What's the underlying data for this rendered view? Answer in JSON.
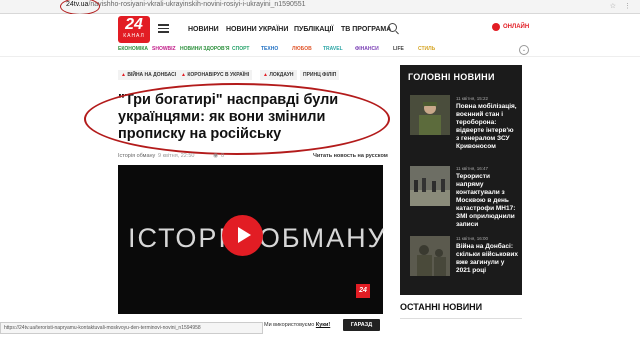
{
  "browser": {
    "url_prefix": "24tv.ua",
    "url_rest": "/navishho-rosiyani-vkrali-ukrayinskih-novini-rosiyi-i-ukrayini_n1590551"
  },
  "header": {
    "logo_number": "24",
    "logo_sub": "КАНАЛ",
    "nav": [
      "НОВИНИ",
      "НОВИНИ УКРАЇНИ",
      "ПУБЛІКАЦІЇ",
      "ТВ ПРОГРАМА"
    ],
    "online_label": "ОНЛАЙН",
    "colors": {
      "brand": "#e21d24"
    }
  },
  "categories": [
    {
      "label": "ЕКОНОМІКА",
      "color": "#2a8f3a"
    },
    {
      "label": "SHOWBIZ",
      "color": "#c21f8a"
    },
    {
      "label": "НОВИНИ ЗДОРОВ'Я",
      "color": "#2a8f3a"
    },
    {
      "label": "СПОРТ",
      "color": "#27a36b"
    },
    {
      "label": "ТЕХНО",
      "color": "#1f6fc2"
    },
    {
      "label": "ЛЮБОВ",
      "color": "#e0552a"
    },
    {
      "label": "TRAVEL",
      "color": "#2aa5a5"
    },
    {
      "label": "ФІНАНСИ",
      "color": "#7a3fb5"
    },
    {
      "label": "LIFE",
      "color": "#444444"
    },
    {
      "label": "СТИЛЬ",
      "color": "#d6a524"
    }
  ],
  "tags": [
    "ВІЙНА НА ДОНБАСІ",
    "КОРОНАВІРУС В УКРАЇНІ",
    "ЛОКДАУН",
    "ПРИНЦ ФІЛІП"
  ],
  "article": {
    "headline": "\"Три богатирі\" насправді були українцями: як вони змінили прописку на російську",
    "category": "Історія обману",
    "time": "9 квітня, 22:50",
    "views": "0",
    "read_ru": "Читать новость на русском",
    "video_title": "ІСТОРІЯ ОБМАНУ"
  },
  "sidebar": {
    "title": "ГОЛОВНІ НОВИНИ",
    "items": [
      {
        "time": "11 квітня, 15:22",
        "text": "Повна мобілізація, воєнний стан і тероборона: відверте інтерв'ю з генералом ЗСУ Кривоносом"
      },
      {
        "time": "11 квітня, 16:47",
        "text": "Терористи напряму контактували з Москвою в день катастрофи МН17: ЗМІ оприлюднили записи"
      },
      {
        "time": "11 квітня, 16:00",
        "text": "Війна на Донбасі: скільки військових вже загинули у 2021 році"
      }
    ],
    "last_news": "ОСТАННІ НОВИНИ"
  },
  "statusbar": {
    "url": "https://24tv.ua/teroristi-napryamu-kontaktuvali-moskvoyu-den-terminovi-novini_n1594958"
  },
  "cookie": {
    "text": "Ми використовуємо",
    "link": "Куки!",
    "button": "ГАРАЗД"
  }
}
